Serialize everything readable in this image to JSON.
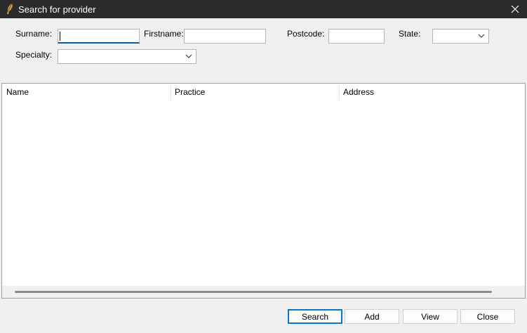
{
  "window": {
    "title": "Search for provider"
  },
  "form": {
    "surname_label": "Surname:",
    "surname_value": "",
    "firstname_label": "Firstname:",
    "firstname_value": "",
    "postcode_label": "Postcode:",
    "postcode_value": "",
    "state_label": "State:",
    "state_value": "",
    "specialty_label": "Specialty:",
    "specialty_value": ""
  },
  "results": {
    "columns": [
      "Name",
      "Practice",
      "Address"
    ],
    "rows": []
  },
  "buttons": {
    "search": "Search",
    "add": "Add",
    "view": "View",
    "close": "Close"
  },
  "colors": {
    "titlebar": "#2b2b2b",
    "focus_accent": "#0063b1",
    "default_button_border": "#0078d4"
  },
  "icons": {
    "app": "quill-feather-icon",
    "close": "close-icon",
    "dropdown": "chevron-down-icon"
  }
}
